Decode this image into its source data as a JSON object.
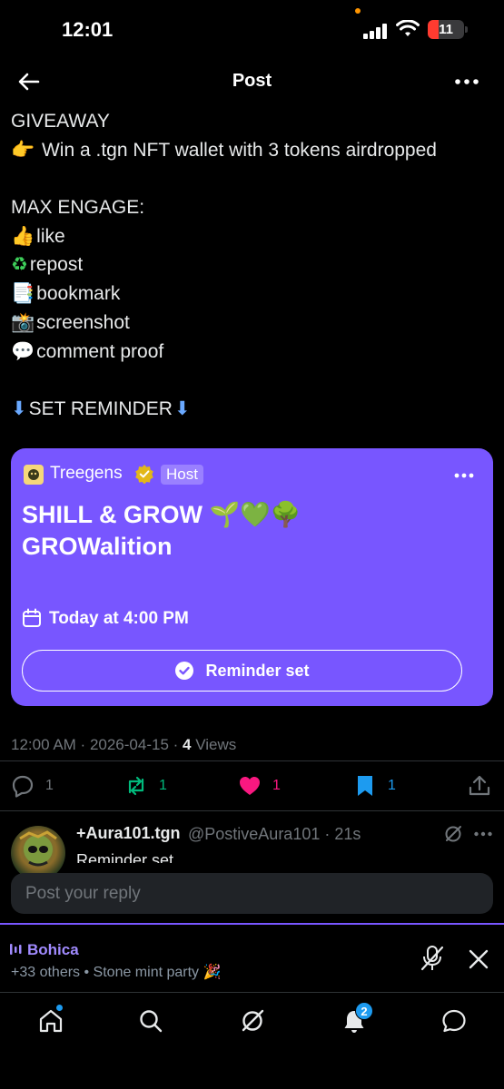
{
  "status_bar": {
    "time": "12:01",
    "battery": "11"
  },
  "header": {
    "title": "Post"
  },
  "tweet": {
    "lines": [
      {
        "emoji": "",
        "text": "GIVEAWAY"
      },
      {
        "emoji": "👉",
        "text": " Win a .tgn NFT wallet with 3 tokens airdropped"
      },
      {
        "emoji": "",
        "text": ""
      },
      {
        "emoji": "",
        "text": "MAX ENGAGE:"
      },
      {
        "emoji": "👍",
        "text": "like"
      },
      {
        "emoji": "♻",
        "text": "repost"
      },
      {
        "emoji": "📑",
        "text": "bookmark"
      },
      {
        "emoji": "📸",
        "text": "screenshot"
      },
      {
        "emoji": "💬",
        "text": "comment proof"
      },
      {
        "emoji": "",
        "text": ""
      },
      {
        "emoji": "⬇",
        "text": "SET REMINDER",
        "emoji_after": "⬇"
      }
    ]
  },
  "space_card": {
    "host_name": "Treegens",
    "host_badge": "Host",
    "title_line1": "SHILL & GROW 🌱💚🌳",
    "title_line2": "GROWalition",
    "time": "Today at 4:00 PM",
    "reminder_label": "Reminder set",
    "accent_color": "#7856ff"
  },
  "meta": {
    "time": "12:00 AM",
    "date": "2026-04-15",
    "views_count": "4",
    "views_label": "Views"
  },
  "actions": {
    "replies": "1",
    "reposts": "1",
    "likes": "1",
    "bookmarks": "1"
  },
  "reply": {
    "name": "+Aura101.tgn",
    "handle": "@PostiveAura101 · 21s",
    "text": "Reminder set"
  },
  "composer": {
    "placeholder": "Post your reply"
  },
  "dock": {
    "title": "Bohica",
    "subtitle": "+33 others • Stone mint party 🎉"
  },
  "tabbar": {
    "notification_count": "2"
  },
  "colors": {
    "repost_green": "#00ba7c",
    "like_pink": "#f91880",
    "bookmark_blue": "#1d9bf0",
    "muted": "#71767b"
  }
}
